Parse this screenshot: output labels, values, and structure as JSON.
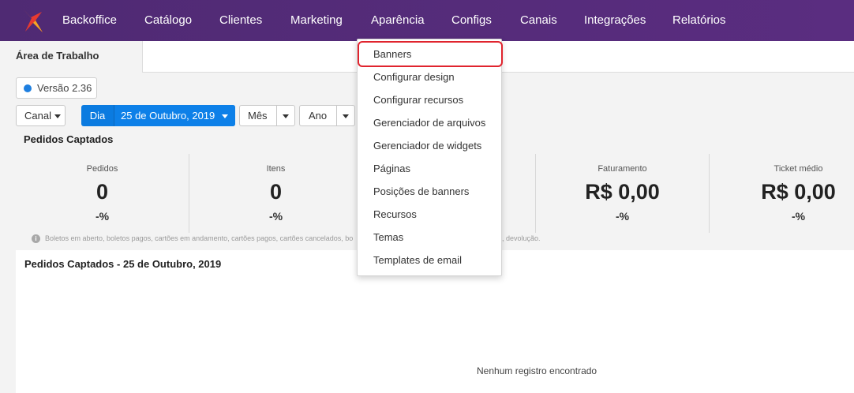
{
  "nav": {
    "items": [
      {
        "label": "Backoffice"
      },
      {
        "label": "Catálogo"
      },
      {
        "label": "Clientes"
      },
      {
        "label": "Marketing"
      },
      {
        "label": "Aparência"
      },
      {
        "label": "Configs"
      },
      {
        "label": "Canais"
      },
      {
        "label": "Integrações"
      },
      {
        "label": "Relatórios"
      }
    ],
    "brand_color": "#56297a",
    "logo_icon": "brand-logo-icon"
  },
  "tabs": {
    "active_label": "Área de Trabalho"
  },
  "version": {
    "label": "Versão 2.36",
    "dot_color": "#1e7fe0"
  },
  "filters": {
    "canal_label": "Canal",
    "dia_label": "Dia",
    "date_value": "25 de Outubro, 2019",
    "mes_label": "Mês",
    "ano_label": "Ano",
    "accent_color": "#0b7be0"
  },
  "summary": {
    "title": "Pedidos Captados",
    "stats": [
      {
        "label": "Pedidos",
        "value": "0",
        "pct": "-%"
      },
      {
        "label": "Itens",
        "value": "0",
        "pct": "-%"
      },
      {
        "label": "Faturamento",
        "value": "R$ 0,00",
        "pct": "-%"
      },
      {
        "label": "Ticket médio",
        "value": "R$ 0,00",
        "pct": "-%"
      }
    ],
    "footnote_left": "Boletos em aberto, boletos pagos, cartões em andamento, cartões pagos, cartões cancelados, bo",
    "footnote_right": ", devolução."
  },
  "chart_panel": {
    "title": "Pedidos Captados - 25 de Outubro, 2019",
    "empty_message": "Nenhum registro encontrado"
  },
  "dropdown": {
    "items": [
      {
        "label": "Banners"
      },
      {
        "label": "Configurar design"
      },
      {
        "label": "Configurar recursos"
      },
      {
        "label": "Gerenciador de arquivos"
      },
      {
        "label": "Gerenciador de widgets"
      },
      {
        "label": "Páginas"
      },
      {
        "label": "Posições de banners"
      },
      {
        "label": "Recursos"
      },
      {
        "label": "Temas"
      },
      {
        "label": "Templates de email"
      }
    ],
    "highlight_color": "#e0242e"
  }
}
